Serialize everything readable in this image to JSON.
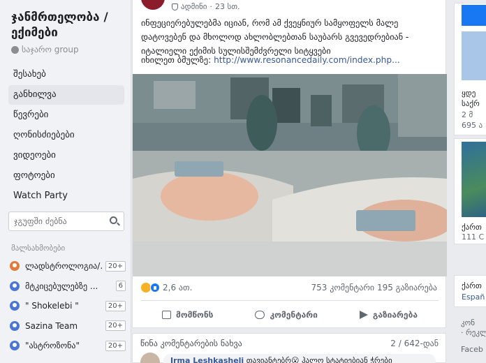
{
  "group": {
    "title": "ჯანმრთელობა / ექიმები",
    "privacy": "საჯარო group"
  },
  "nav": [
    {
      "label": "შესახებ",
      "active": false
    },
    {
      "label": "განხილვა",
      "active": true
    },
    {
      "label": "წევრები",
      "active": false
    },
    {
      "label": "ღონისძიებები",
      "active": false
    },
    {
      "label": "ვიდეოები",
      "active": false
    },
    {
      "label": "ფოტოები",
      "active": false
    },
    {
      "label": "Watch Party",
      "active": false
    }
  ],
  "search": {
    "placeholder": "ჯგუფში ძებნა"
  },
  "members_label": "მალსახმობები",
  "members": [
    {
      "name": "ლადსტროლოგია/...",
      "badge": "20+"
    },
    {
      "name": "მტკიცებულებზე ...",
      "badge": "6"
    },
    {
      "name": "\" Shokelebi \"",
      "badge": "20+"
    },
    {
      "name": "Sazina Team",
      "badge": "20+"
    },
    {
      "name": "\"ასტროზონა\"",
      "badge": "20+"
    }
  ],
  "post": {
    "author": "ადმინი",
    "time": "23 სთ.",
    "text": "ინფეციერებულებმა იციან, რომ ამ ქვეყნიურ სამყოფელს მალე დატოვებენ და მხოლოდ ახლობლებთან საუბარს გვევედრებიან - იტალიელი ექიმის სულისშემძვრელი სიტყვები",
    "link_prefix": "იხილეთ ბმულზე:",
    "link_url": "http://www.resonancedaily.com/index.php...",
    "reaction_count": "2,6 ათ.",
    "comments_count": "753 კომენტარი",
    "shares_count": "195 გაზიარება",
    "actions": {
      "like": "მომწონს",
      "comment": "კომენტარი",
      "share": "გაზიარება"
    }
  },
  "comments": {
    "prev_label": "წინა კომენტარების ნახვა",
    "page_count": "2 / 642-დან",
    "first_commenter": "Irma Leshkasheli",
    "first_comment_text": "თავიანტებრ😮 ჰალო სტატიებიან ჭრები"
  },
  "right": {
    "card1_lines": [
      "ყდე",
      "საქრ",
      "2 მ",
      "695 ა"
    ],
    "card2_lines": [
      "ქართ",
      "111 C"
    ],
    "card3_lines": [
      "ქართ",
      "Españ"
    ],
    "card4_lines": [
      "კონ",
      "· რეკლ",
      "Faceb"
    ]
  },
  "colors": {
    "link": "#385898",
    "background": "#e9ebee",
    "accent": "#1877f2"
  },
  "icons": {
    "search": "search-icon",
    "like": "like-icon",
    "comment": "comment-icon",
    "share": "share-icon",
    "globe": "globe-icon",
    "shield": "shield-icon"
  }
}
